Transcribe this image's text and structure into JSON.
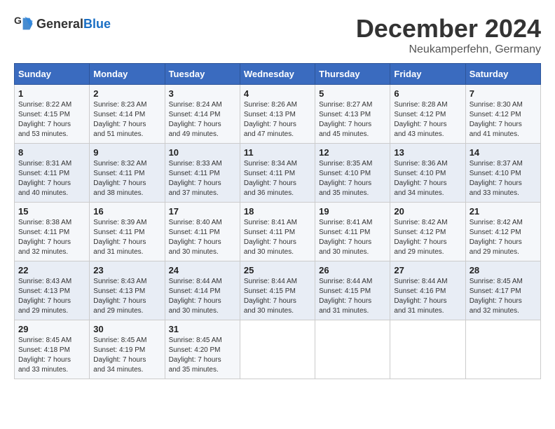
{
  "header": {
    "logo_general": "General",
    "logo_blue": "Blue",
    "month": "December 2024",
    "location": "Neukamperfehn, Germany"
  },
  "days_of_week": [
    "Sunday",
    "Monday",
    "Tuesday",
    "Wednesday",
    "Thursday",
    "Friday",
    "Saturday"
  ],
  "weeks": [
    [
      {
        "day": "1",
        "sunrise": "8:22 AM",
        "sunset": "4:15 PM",
        "daylight": "7 hours and 53 minutes."
      },
      {
        "day": "2",
        "sunrise": "8:23 AM",
        "sunset": "4:14 PM",
        "daylight": "7 hours and 51 minutes."
      },
      {
        "day": "3",
        "sunrise": "8:24 AM",
        "sunset": "4:14 PM",
        "daylight": "7 hours and 49 minutes."
      },
      {
        "day": "4",
        "sunrise": "8:26 AM",
        "sunset": "4:13 PM",
        "daylight": "7 hours and 47 minutes."
      },
      {
        "day": "5",
        "sunrise": "8:27 AM",
        "sunset": "4:13 PM",
        "daylight": "7 hours and 45 minutes."
      },
      {
        "day": "6",
        "sunrise": "8:28 AM",
        "sunset": "4:12 PM",
        "daylight": "7 hours and 43 minutes."
      },
      {
        "day": "7",
        "sunrise": "8:30 AM",
        "sunset": "4:12 PM",
        "daylight": "7 hours and 41 minutes."
      }
    ],
    [
      {
        "day": "8",
        "sunrise": "8:31 AM",
        "sunset": "4:11 PM",
        "daylight": "7 hours and 40 minutes."
      },
      {
        "day": "9",
        "sunrise": "8:32 AM",
        "sunset": "4:11 PM",
        "daylight": "7 hours and 38 minutes."
      },
      {
        "day": "10",
        "sunrise": "8:33 AM",
        "sunset": "4:11 PM",
        "daylight": "7 hours and 37 minutes."
      },
      {
        "day": "11",
        "sunrise": "8:34 AM",
        "sunset": "4:11 PM",
        "daylight": "7 hours and 36 minutes."
      },
      {
        "day": "12",
        "sunrise": "8:35 AM",
        "sunset": "4:10 PM",
        "daylight": "7 hours and 35 minutes."
      },
      {
        "day": "13",
        "sunrise": "8:36 AM",
        "sunset": "4:10 PM",
        "daylight": "7 hours and 34 minutes."
      },
      {
        "day": "14",
        "sunrise": "8:37 AM",
        "sunset": "4:10 PM",
        "daylight": "7 hours and 33 minutes."
      }
    ],
    [
      {
        "day": "15",
        "sunrise": "8:38 AM",
        "sunset": "4:11 PM",
        "daylight": "7 hours and 32 minutes."
      },
      {
        "day": "16",
        "sunrise": "8:39 AM",
        "sunset": "4:11 PM",
        "daylight": "7 hours and 31 minutes."
      },
      {
        "day": "17",
        "sunrise": "8:40 AM",
        "sunset": "4:11 PM",
        "daylight": "7 hours and 30 minutes."
      },
      {
        "day": "18",
        "sunrise": "8:41 AM",
        "sunset": "4:11 PM",
        "daylight": "7 hours and 30 minutes."
      },
      {
        "day": "19",
        "sunrise": "8:41 AM",
        "sunset": "4:11 PM",
        "daylight": "7 hours and 30 minutes."
      },
      {
        "day": "20",
        "sunrise": "8:42 AM",
        "sunset": "4:12 PM",
        "daylight": "7 hours and 29 minutes."
      },
      {
        "day": "21",
        "sunrise": "8:42 AM",
        "sunset": "4:12 PM",
        "daylight": "7 hours and 29 minutes."
      }
    ],
    [
      {
        "day": "22",
        "sunrise": "8:43 AM",
        "sunset": "4:13 PM",
        "daylight": "7 hours and 29 minutes."
      },
      {
        "day": "23",
        "sunrise": "8:43 AM",
        "sunset": "4:13 PM",
        "daylight": "7 hours and 29 minutes."
      },
      {
        "day": "24",
        "sunrise": "8:44 AM",
        "sunset": "4:14 PM",
        "daylight": "7 hours and 30 minutes."
      },
      {
        "day": "25",
        "sunrise": "8:44 AM",
        "sunset": "4:15 PM",
        "daylight": "7 hours and 30 minutes."
      },
      {
        "day": "26",
        "sunrise": "8:44 AM",
        "sunset": "4:15 PM",
        "daylight": "7 hours and 31 minutes."
      },
      {
        "day": "27",
        "sunrise": "8:44 AM",
        "sunset": "4:16 PM",
        "daylight": "7 hours and 31 minutes."
      },
      {
        "day": "28",
        "sunrise": "8:45 AM",
        "sunset": "4:17 PM",
        "daylight": "7 hours and 32 minutes."
      }
    ],
    [
      {
        "day": "29",
        "sunrise": "8:45 AM",
        "sunset": "4:18 PM",
        "daylight": "7 hours and 33 minutes."
      },
      {
        "day": "30",
        "sunrise": "8:45 AM",
        "sunset": "4:19 PM",
        "daylight": "7 hours and 34 minutes."
      },
      {
        "day": "31",
        "sunrise": "8:45 AM",
        "sunset": "4:20 PM",
        "daylight": "7 hours and 35 minutes."
      },
      null,
      null,
      null,
      null
    ]
  ],
  "labels": {
    "sunrise": "Sunrise:",
    "sunset": "Sunset:",
    "daylight": "Daylight:"
  }
}
